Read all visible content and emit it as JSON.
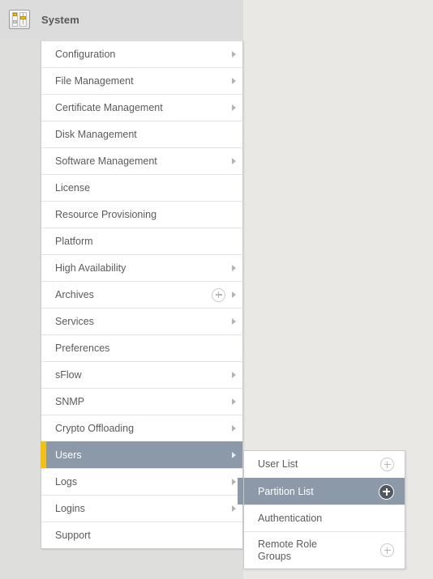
{
  "header": {
    "title": "System",
    "icon": "system-sliders-icon"
  },
  "colors": {
    "selection_bg": "#8c99a8",
    "selection_accent": "#f5c014",
    "panel_bg": "#ffffff",
    "page_bg": "#e9e8e5",
    "text": "#5b5b5d"
  },
  "main_menu": {
    "items": [
      {
        "label": "Configuration",
        "has_caret": true,
        "has_plus": false,
        "selected": false
      },
      {
        "label": "File Management",
        "has_caret": true,
        "has_plus": false,
        "selected": false
      },
      {
        "label": "Certificate Management",
        "has_caret": true,
        "has_plus": false,
        "selected": false
      },
      {
        "label": "Disk Management",
        "has_caret": false,
        "has_plus": false,
        "selected": false
      },
      {
        "label": "Software Management",
        "has_caret": true,
        "has_plus": false,
        "selected": false
      },
      {
        "label": "License",
        "has_caret": false,
        "has_plus": false,
        "selected": false
      },
      {
        "label": "Resource Provisioning",
        "has_caret": false,
        "has_plus": false,
        "selected": false
      },
      {
        "label": "Platform",
        "has_caret": false,
        "has_plus": false,
        "selected": false
      },
      {
        "label": "High Availability",
        "has_caret": true,
        "has_plus": false,
        "selected": false
      },
      {
        "label": "Archives",
        "has_caret": true,
        "has_plus": true,
        "selected": false
      },
      {
        "label": "Services",
        "has_caret": true,
        "has_plus": false,
        "selected": false
      },
      {
        "label": "Preferences",
        "has_caret": false,
        "has_plus": false,
        "selected": false
      },
      {
        "label": "sFlow",
        "has_caret": true,
        "has_plus": false,
        "selected": false
      },
      {
        "label": "SNMP",
        "has_caret": true,
        "has_plus": false,
        "selected": false
      },
      {
        "label": "Crypto Offloading",
        "has_caret": true,
        "has_plus": false,
        "selected": false
      },
      {
        "label": "Users",
        "has_caret": true,
        "has_plus": false,
        "selected": true
      },
      {
        "label": "Logs",
        "has_caret": true,
        "has_plus": false,
        "selected": false
      },
      {
        "label": "Logins",
        "has_caret": true,
        "has_plus": false,
        "selected": false
      },
      {
        "label": "Support",
        "has_caret": false,
        "has_plus": false,
        "selected": false
      }
    ]
  },
  "sub_menu": {
    "parent": "Users",
    "items": [
      {
        "label": "User List",
        "has_plus": true,
        "selected": false,
        "two_line": false
      },
      {
        "label": "Partition List",
        "has_plus": true,
        "selected": true,
        "two_line": false
      },
      {
        "label": "Authentication",
        "has_plus": false,
        "selected": false,
        "two_line": false
      },
      {
        "label": "Remote Role\nGroups",
        "has_plus": true,
        "selected": false,
        "two_line": true
      }
    ]
  }
}
